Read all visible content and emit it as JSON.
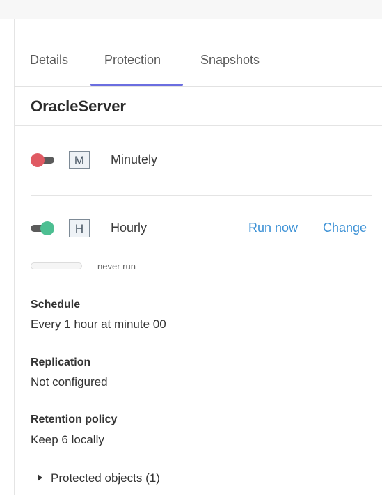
{
  "tabs": [
    "Details",
    "Protection",
    "Snapshots"
  ],
  "active_tab": "Protection",
  "title": "OracleServer",
  "schedules": {
    "minutely": {
      "letter": "M",
      "label": "Minutely",
      "enabled": false
    },
    "hourly": {
      "letter": "H",
      "label": "Hourly",
      "enabled": true,
      "run_now": "Run now",
      "change": "Change"
    }
  },
  "status": {
    "progress": 0,
    "text": "never run"
  },
  "details": {
    "schedule_label": "Schedule",
    "schedule_value": "Every 1 hour at minute 00",
    "replication_label": "Replication",
    "replication_value": "Not configured",
    "retention_label": "Retention policy",
    "retention_value": "Keep 6 locally"
  },
  "protected_objects": "Protected objects (1)",
  "colors": {
    "accent": "#6b6ee0",
    "toggle_off": "#e05a63",
    "toggle_on": "#4dbf92",
    "link": "#3e92d6"
  }
}
